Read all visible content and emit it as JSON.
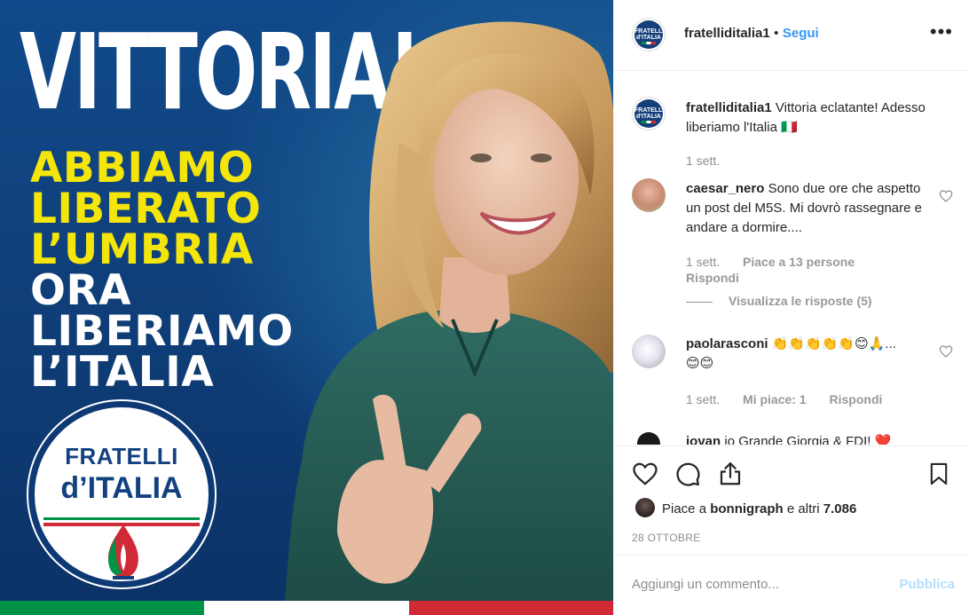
{
  "image": {
    "headline": "VITTORIA!",
    "slogan_yellow": [
      "ABBIAMO",
      "LIBERATO",
      "L’UMBRIA"
    ],
    "slogan_white": [
      "ORA",
      "LIBERIAMO",
      "L’ITALIA"
    ],
    "logo_line1": "FRATELLI",
    "logo_line2": "d’ITALIA",
    "colors": {
      "background": "#114a8a",
      "yellow": "#f4e60a",
      "flag_green": "#009246",
      "flag_white": "#ffffff",
      "flag_red": "#ce2b37"
    }
  },
  "header": {
    "avatar_text": "FRATELLI d'ITALIA",
    "username": "fratelliditalia1",
    "separator": "•",
    "follow_label": "Segui",
    "more_icon": "more-horizontal-icon"
  },
  "caption": {
    "username": "fratelliditalia1",
    "text": "Vittoria eclatante! Adesso liberiamo l'Italia 🇮🇹",
    "time": "1 sett."
  },
  "comments": [
    {
      "username": "caesar_nero",
      "text": "Sono due ore che aspetto un post del M5S. Mi dovrò rassegnare e andare a dormire....",
      "time": "1 sett.",
      "likes": "Piace a 13 persone",
      "reply": "Rispondi",
      "view_replies": "Visualizza le risposte (5)"
    },
    {
      "username": "paolarasconi",
      "text": "👏👏👏👏👏😊🙏...",
      "text2": "😊😊",
      "time": "1 sett.",
      "likes": "Mi piace: 1",
      "reply": "Rispondi"
    },
    {
      "username": "iovan",
      "text": "io Grande Giorgia & FDI! ❤️"
    }
  ],
  "actions": {
    "icons": [
      "heart-icon",
      "comment-icon",
      "share-icon",
      "bookmark-icon"
    ],
    "likes_prefix": "Piace a",
    "likes_user": "bonnigraph",
    "likes_and": "e altri",
    "likes_count": "7.086",
    "date": "28 OTTOBRE"
  },
  "add_comment": {
    "placeholder": "Aggiungi un commento...",
    "publish_label": "Pubblica"
  },
  "accent_color": "#3897f0"
}
